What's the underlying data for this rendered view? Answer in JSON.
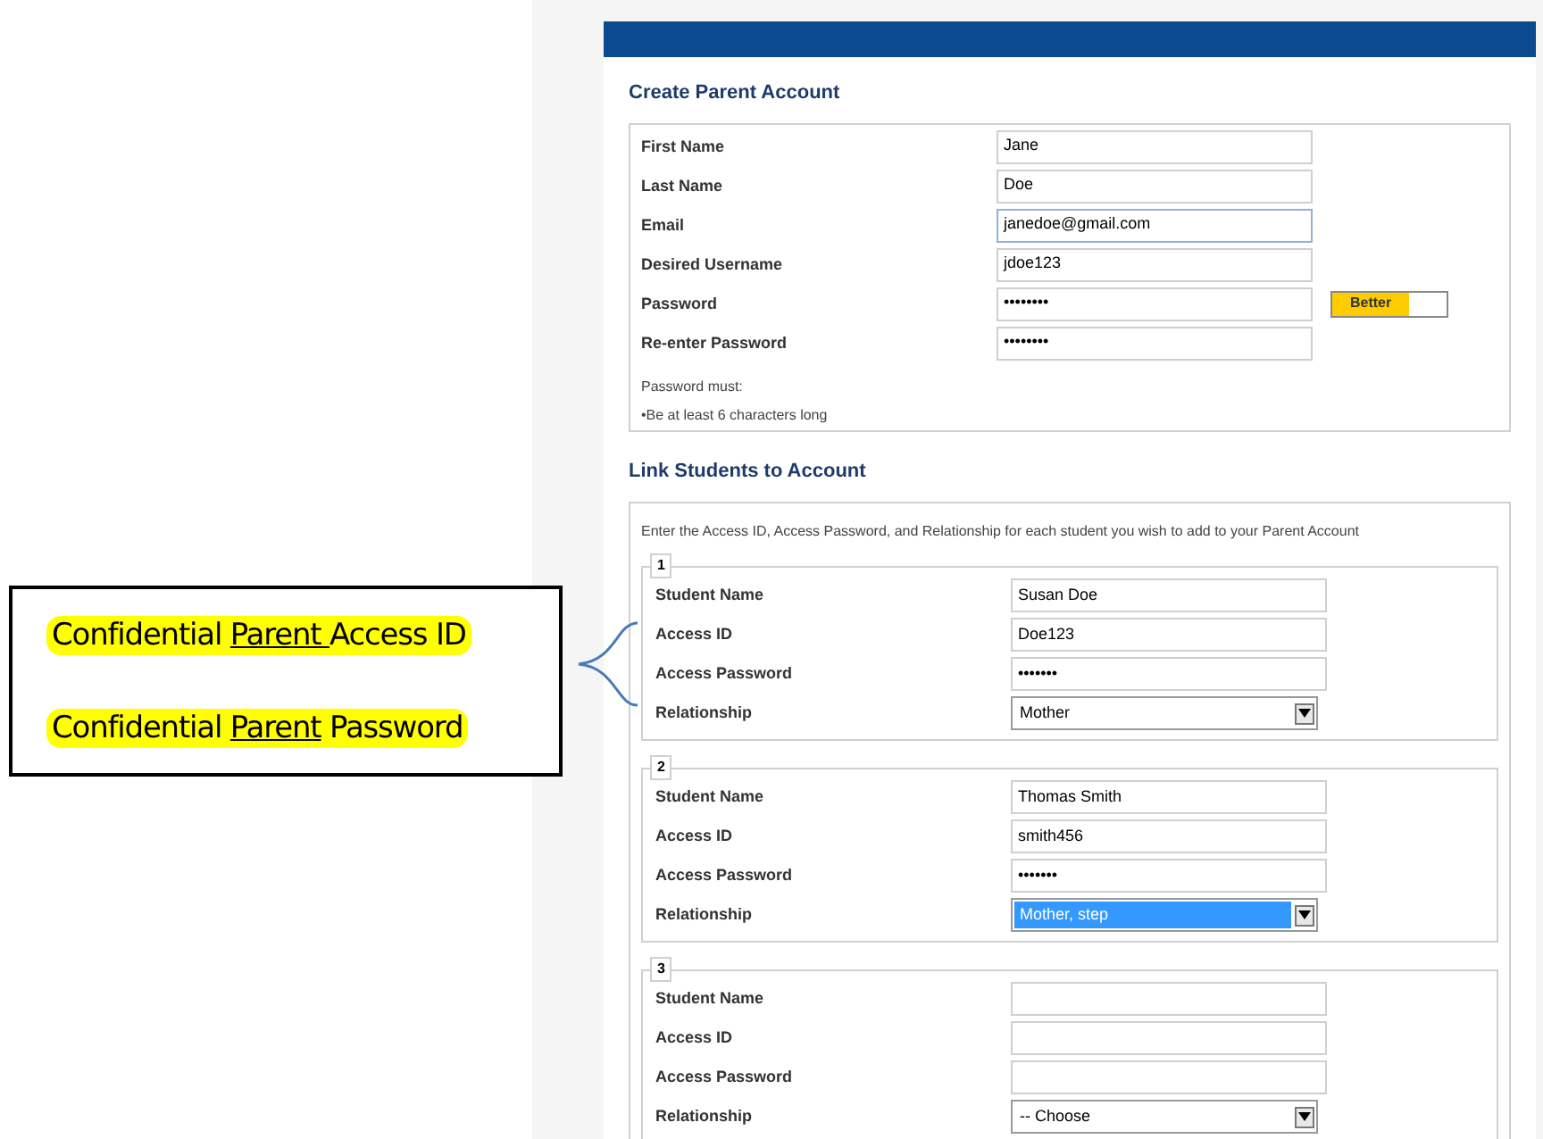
{
  "create_account": {
    "title": "Create Parent Account",
    "fields": [
      {
        "label": "First Name",
        "value": "Jane",
        "focused": false
      },
      {
        "label": "Last Name",
        "value": "Doe",
        "focused": false
      },
      {
        "label": "Email",
        "value": "janedoe@gmail.com",
        "focused": true
      },
      {
        "label": "Desired Username",
        "value": "jdoe123",
        "focused": false
      },
      {
        "label": "Password",
        "value": "••••••••",
        "focused": false,
        "strength": {
          "label": "Better",
          "level": 0.67
        }
      },
      {
        "label": "Re-enter Password",
        "value": "••••••••",
        "focused": false
      }
    ],
    "rules": [
      "Password must:",
      "•Be at least 6 characters long"
    ]
  },
  "link_students": {
    "title": "Link Students to Account",
    "instructions": "Enter the Access ID, Access Password, and Relationship for each student you wish to add to your Parent Account",
    "students": [
      {
        "number": "1",
        "fields": [
          {
            "kind": "text",
            "label": "Student Name",
            "value": "Susan Doe"
          },
          {
            "kind": "text",
            "label": "Access ID",
            "value": "Doe123"
          },
          {
            "kind": "text",
            "label": "Access Password",
            "value": "•••••••"
          },
          {
            "kind": "select",
            "label": "Relationship",
            "value": "Mother",
            "highlighted": false
          }
        ]
      },
      {
        "number": "2",
        "fields": [
          {
            "kind": "text",
            "label": "Student Name",
            "value": "Thomas Smith"
          },
          {
            "kind": "text",
            "label": "Access ID",
            "value": "smith456"
          },
          {
            "kind": "text",
            "label": "Access Password",
            "value": "•••••••"
          },
          {
            "kind": "select",
            "label": "Relationship",
            "value": "Mother, step",
            "highlighted": true
          }
        ]
      },
      {
        "number": "3",
        "fields": [
          {
            "kind": "text",
            "label": "Student Name"
          },
          {
            "kind": "text",
            "label": "Access ID"
          },
          {
            "kind": "text",
            "label": "Access Password"
          },
          {
            "kind": "select",
            "label": "Relationship",
            "value": "-- Choose",
            "highlighted": false
          }
        ]
      }
    ]
  },
  "callout": {
    "lines": [
      [
        {
          "text": "Confidential ",
          "underlined": false
        },
        {
          "text": "Parent ",
          "underlined": true
        },
        {
          "text": "Access ID",
          "underlined": false
        }
      ],
      [
        {
          "text": "Confidential ",
          "underlined": false
        },
        {
          "text": "Parent",
          "underlined": true
        },
        {
          "text": " Password",
          "underlined": false
        }
      ]
    ]
  }
}
